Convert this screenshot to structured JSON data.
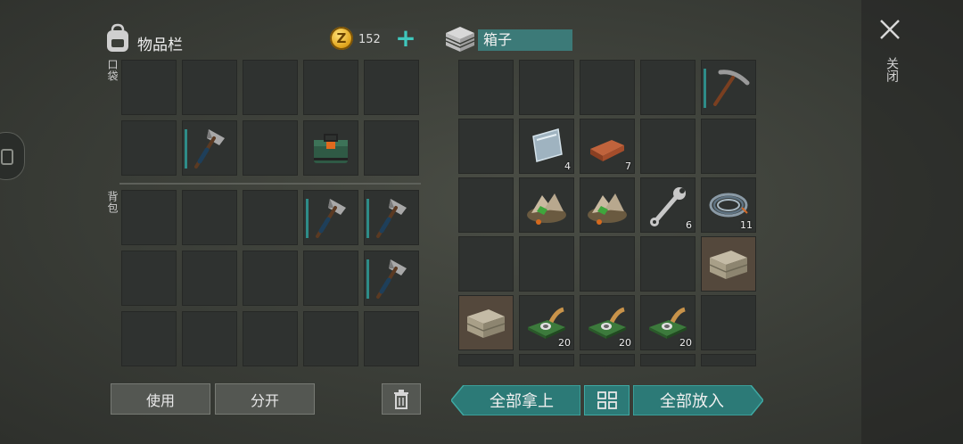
{
  "inventory": {
    "title": "物品栏",
    "coins": "152",
    "pocket_label": "口袋",
    "backpack_label": "背包"
  },
  "box": {
    "title": "箱子"
  },
  "buttons": {
    "use": "使用",
    "split": "分开",
    "take_all": "全部拿上",
    "put_all": "全部放入"
  },
  "close_label": "关闭",
  "box_items": [
    {
      "name": "steel-plate",
      "qty": "4"
    },
    {
      "name": "copper-ingot",
      "qty": "7"
    },
    {
      "name": "ore-pile",
      "qty": ""
    },
    {
      "name": "ore-pile",
      "qty": ""
    },
    {
      "name": "wrench",
      "qty": "6"
    },
    {
      "name": "wire-coil",
      "qty": "11"
    },
    {
      "name": "circuit-board",
      "qty": "20"
    },
    {
      "name": "circuit-board",
      "qty": "20"
    },
    {
      "name": "circuit-board",
      "qty": "20"
    }
  ],
  "colors": {
    "accent": "#2c7a77",
    "slot": "#2f3230",
    "highlight": "#54483c"
  }
}
